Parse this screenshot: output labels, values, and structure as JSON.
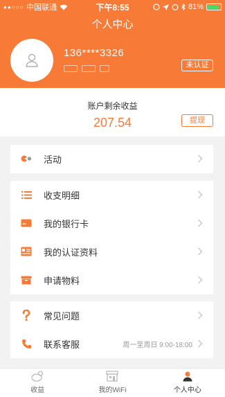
{
  "status_bar": {
    "carrier": "中国联通",
    "time": "下午8:55",
    "battery": "81%"
  },
  "nav": {
    "title": "个人中心"
  },
  "profile": {
    "phone": "136****3326",
    "verify_label": "未认证"
  },
  "balance": {
    "label": "账户剩余收益",
    "value": "207.54",
    "withdraw_label": "提现"
  },
  "menu_group1": [
    {
      "label": "活动",
      "icon": "activity-icon"
    }
  ],
  "menu_group2": [
    {
      "label": "收支明细",
      "icon": "list-icon"
    },
    {
      "label": "我的银行卡",
      "icon": "bank-card-icon"
    },
    {
      "label": "我的认证资料",
      "icon": "id-card-icon"
    },
    {
      "label": "申请物料",
      "icon": "package-icon"
    }
  ],
  "menu_group3": [
    {
      "label": "常见问题",
      "icon": "question-icon"
    },
    {
      "label": "联系客服",
      "icon": "phone-icon",
      "extra": "周一至周日 9:00-18:00"
    }
  ],
  "tabbar": {
    "tabs": [
      {
        "label": "收益",
        "icon": "earnings-icon"
      },
      {
        "label": "我的WiFi",
        "icon": "wifi-shop-icon"
      },
      {
        "label": "个人中心",
        "icon": "person-icon"
      }
    ]
  },
  "colors": {
    "accent": "#f77b36",
    "background": "#f2f2f2"
  }
}
